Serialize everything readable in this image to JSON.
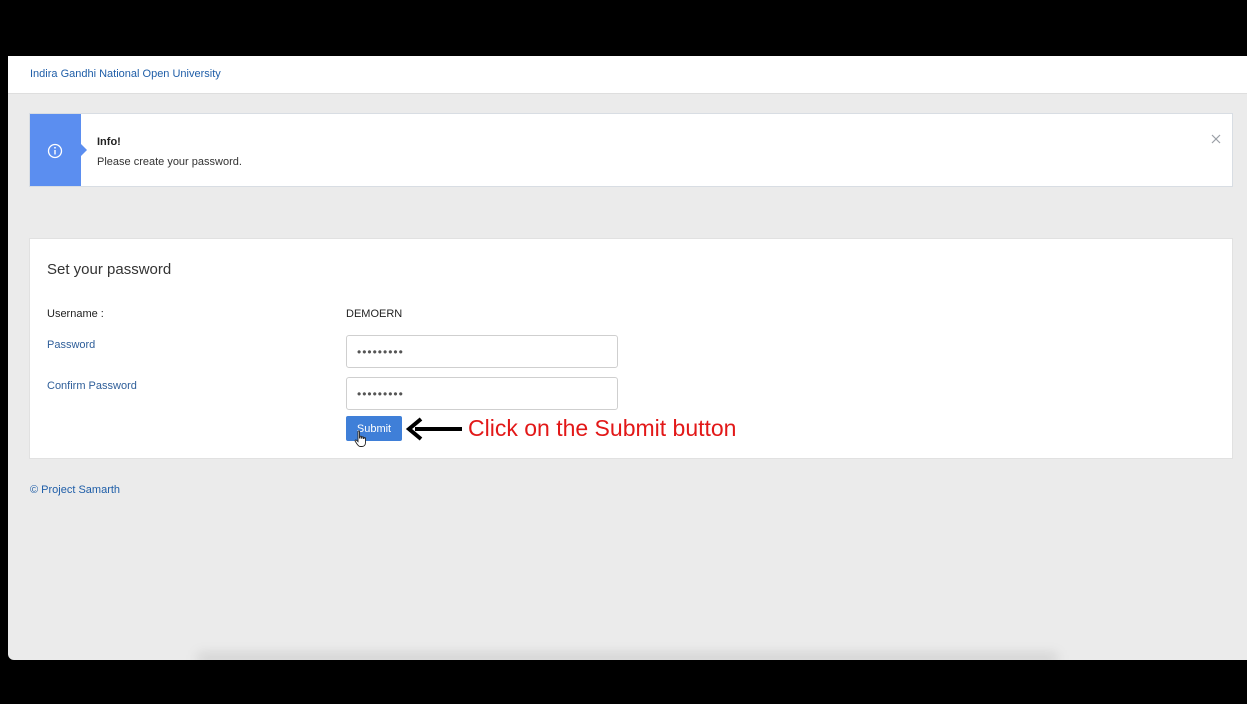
{
  "navbar": {
    "brand": "Indira Gandhi National Open University"
  },
  "alert": {
    "icon": "info-icon",
    "title": "Info!",
    "message": "Please create your password.",
    "close_icon": "close-icon",
    "accent_color": "#5b8ef0"
  },
  "form": {
    "title": "Set your password",
    "username_label": "Username :",
    "username_value": "DEMOERN",
    "password_label": "Password",
    "password_value": "•••••••••",
    "confirm_label": "Confirm Password",
    "confirm_value": "•••••••••",
    "submit_label": "Submit",
    "submit_color": "#3f7fd8"
  },
  "annotation": {
    "text": "Click on the Submit button",
    "color": "#e21818"
  },
  "footer": {
    "text": "© Project Samarth"
  }
}
